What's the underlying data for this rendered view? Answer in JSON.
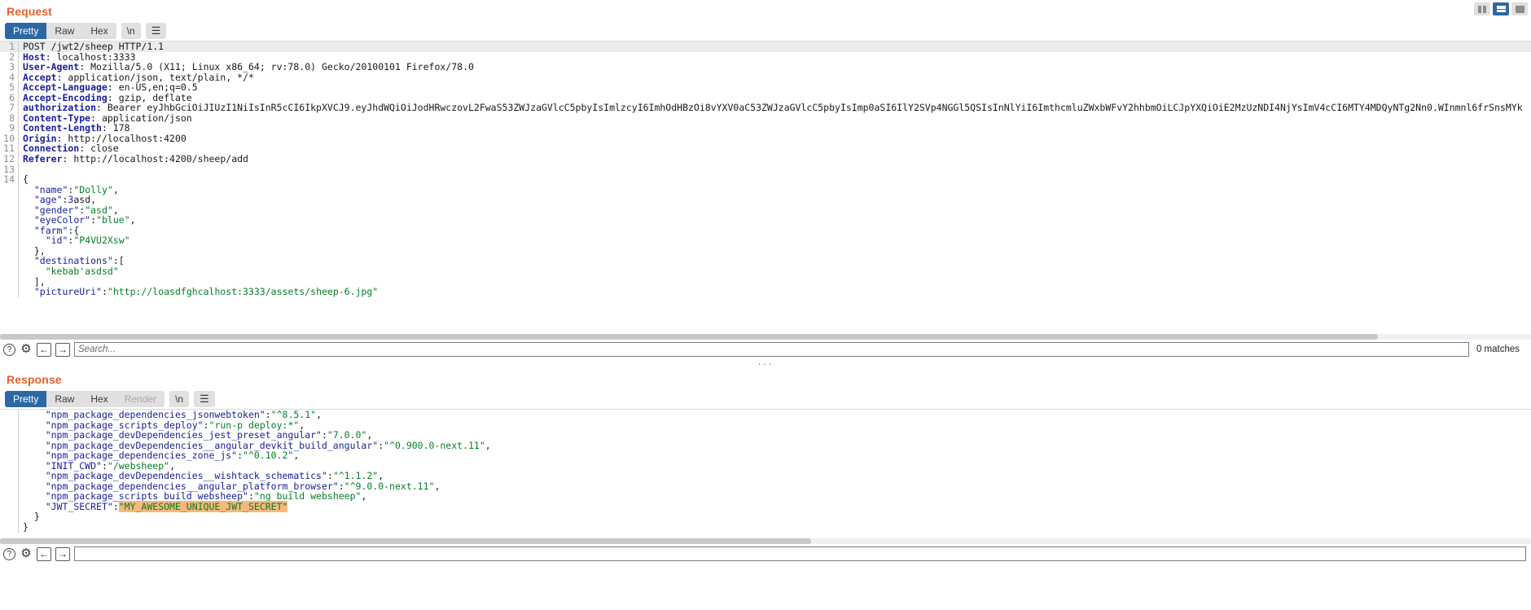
{
  "window_controls": [
    {
      "name": "split-vertical-icon",
      "selected": false
    },
    {
      "name": "split-horizontal-icon",
      "selected": true
    },
    {
      "name": "single-pane-icon",
      "selected": false
    }
  ],
  "request": {
    "title": "Request",
    "tabs": [
      {
        "label": "Pretty",
        "active": true,
        "disabled": false
      },
      {
        "label": "Raw",
        "active": false,
        "disabled": false
      },
      {
        "label": "Hex",
        "active": false,
        "disabled": false
      }
    ],
    "newline_button": "\\n",
    "menu_button": "☰",
    "lines": [
      {
        "n": "1",
        "type": "request-line",
        "text": "POST /jwt2/sheep HTTP/1.1"
      },
      {
        "n": "2",
        "type": "header",
        "key": "Host",
        "value": "localhost:3333"
      },
      {
        "n": "3",
        "type": "header",
        "key": "User-Agent",
        "value": "Mozilla/5.0 (X11; Linux x86_64; rv:78.0) Gecko/20100101 Firefox/78.0"
      },
      {
        "n": "4",
        "type": "header",
        "key": "Accept",
        "value": "application/json, text/plain, */*"
      },
      {
        "n": "5",
        "type": "header",
        "key": "Accept-Language",
        "value": "en-US,en;q=0.5"
      },
      {
        "n": "6",
        "type": "header",
        "key": "Accept-Encoding",
        "value": "gzip, deflate"
      },
      {
        "n": "7",
        "type": "header",
        "key": "authorization",
        "value": "Bearer eyJhbGciOiJIUzI1NiIsInR5cCI6IkpXVCJ9.eyJhdWQiOiJodHRwczovL2FwaS53ZWJzaGVlcC5pbyIsImlzcyI6ImhOdHBzOi8vYXV0aC53ZWJzaGVlcC5pbyIsImp0aSI6IlY2SVp4NGGl5QSIsInNlYiI6ImthcmluZWxbWFvY2hhbmOiLCJpYXQiOiE2MzUzNDI4NjYsImV4cCI6MTY4MDQyNTg2Nn0.WInmnl6frSnsMYk"
      },
      {
        "n": "8",
        "type": "header",
        "key": "Content-Type",
        "value": "application/json"
      },
      {
        "n": "9",
        "type": "header",
        "key": "Content-Length",
        "value": "178"
      },
      {
        "n": "10",
        "type": "header",
        "key": "Origin",
        "value": "http://localhost:4200"
      },
      {
        "n": "11",
        "type": "header",
        "key": "Connection",
        "value": "close"
      },
      {
        "n": "12",
        "type": "header",
        "key": "Referer",
        "value": "http://localhost:4200/sheep/add"
      },
      {
        "n": "13",
        "type": "blank",
        "text": ""
      },
      {
        "n": "14",
        "type": "json-punct",
        "text": "{"
      },
      {
        "n": "",
        "type": "json-kv",
        "indent": 2,
        "key": "\"name\"",
        "value": "\"Dolly\"",
        "valtype": "str",
        "trail": ","
      },
      {
        "n": "",
        "type": "json-kv",
        "indent": 2,
        "key": "\"age\"",
        "value": "3",
        "valtype": "num",
        "extra": "asd",
        "trail": ","
      },
      {
        "n": "",
        "type": "json-kv",
        "indent": 2,
        "key": "\"gender\"",
        "value": "\"asd\"",
        "valtype": "str",
        "trail": ","
      },
      {
        "n": "",
        "type": "json-kv",
        "indent": 2,
        "key": "\"eyeColor\"",
        "value": "\"blue\"",
        "valtype": "str",
        "trail": ","
      },
      {
        "n": "",
        "type": "json-kv",
        "indent": 2,
        "key": "\"farm\"",
        "value": "{",
        "valtype": "punct",
        "trail": ""
      },
      {
        "n": "",
        "type": "json-kv",
        "indent": 4,
        "key": "\"id\"",
        "value": "\"P4VU2Xsw\"",
        "valtype": "str",
        "trail": ""
      },
      {
        "n": "",
        "type": "json-punct",
        "indent": 2,
        "text": "},"
      },
      {
        "n": "",
        "type": "json-kv",
        "indent": 2,
        "key": "\"destinations\"",
        "value": "[",
        "valtype": "punct",
        "trail": ""
      },
      {
        "n": "",
        "type": "json-str-only",
        "indent": 4,
        "text": "\"kebab'asdsd\""
      },
      {
        "n": "",
        "type": "json-punct",
        "indent": 2,
        "text": "],"
      },
      {
        "n": "",
        "type": "json-kv",
        "indent": 2,
        "key": "\"pictureUri\"",
        "value": "\"http://loasdfghcalhost:3333/assets/sheep-6.jpg\"",
        "valtype": "str",
        "trail": ""
      }
    ],
    "search": {
      "help_icon": "?",
      "settings_icon": "gear",
      "prev_label": "←",
      "next_label": "→",
      "placeholder": "Search...",
      "value": "",
      "matches": "0 matches"
    },
    "scrollbar_thumb_pct": 90
  },
  "splitter": {
    "handle": "···"
  },
  "response": {
    "title": "Response",
    "tabs": [
      {
        "label": "Pretty",
        "active": true,
        "disabled": false
      },
      {
        "label": "Raw",
        "active": false,
        "disabled": false
      },
      {
        "label": "Hex",
        "active": false,
        "disabled": false
      },
      {
        "label": "Render",
        "active": false,
        "disabled": true
      }
    ],
    "newline_button": "\\n",
    "menu_button": "☰",
    "lines": [
      {
        "type": "json-kv",
        "indent": 4,
        "key": "\"npm_package_dependencies_jsonwebtoken\"",
        "value": "\"^8.5.1\"",
        "valtype": "str",
        "trail": ","
      },
      {
        "type": "json-kv",
        "indent": 4,
        "key": "\"npm_package_scripts_deploy\"",
        "value": "\"run-p deploy:*\"",
        "valtype": "str",
        "trail": ","
      },
      {
        "type": "json-kv",
        "indent": 4,
        "key": "\"npm_package_devDependencies_jest_preset_angular\"",
        "value": "\"7.0.0\"",
        "valtype": "str",
        "trail": ","
      },
      {
        "type": "json-kv",
        "indent": 4,
        "key": "\"npm_package_devDependencies__angular_devkit_build_angular\"",
        "value": "\"^0.900.0-next.11\"",
        "valtype": "str",
        "trail": ","
      },
      {
        "type": "json-kv",
        "indent": 4,
        "key": "\"npm_package_dependencies_zone_js\"",
        "value": "\"^0.10.2\"",
        "valtype": "str",
        "trail": ","
      },
      {
        "type": "json-kv",
        "indent": 4,
        "key": "\"INIT_CWD\"",
        "value": "\"/websheep\"",
        "valtype": "str",
        "trail": ","
      },
      {
        "type": "json-kv",
        "indent": 4,
        "key": "\"npm_package_devDependencies__wishtack_schematics\"",
        "value": "\"^1.1.2\"",
        "valtype": "str",
        "trail": ","
      },
      {
        "type": "json-kv",
        "indent": 4,
        "key": "\"npm_package_dependencies__angular_platform_browser\"",
        "value": "\"^9.0.0-next.11\"",
        "valtype": "str",
        "trail": ","
      },
      {
        "type": "json-kv",
        "indent": 4,
        "key": "\"npm_package_scripts_build_websheep\"",
        "value": "\"ng build websheep\"",
        "valtype": "str",
        "trail": ","
      },
      {
        "type": "json-kv",
        "indent": 4,
        "key": "\"JWT_SECRET\"",
        "value": "\"MY_AWESOME_UNIQUE_JWT_SECRET\"",
        "valtype": "str",
        "trail": "",
        "highlight": true
      },
      {
        "type": "json-punct",
        "indent": 2,
        "text": "}"
      },
      {
        "type": "json-punct",
        "indent": 0,
        "text": "}"
      }
    ],
    "scrollbar_thumb_pct": 53,
    "search": {
      "help_icon": "?",
      "settings_icon": "gear",
      "prev_label": "←",
      "next_label": "→",
      "placeholder": "",
      "value": ""
    }
  },
  "colors": {
    "accent_orange": "#e8602c",
    "tab_active_blue": "#2d68a4",
    "json_key_blue": "#18209c",
    "json_string_green": "#077d27",
    "highlight_orange": "#f6b87c"
  }
}
